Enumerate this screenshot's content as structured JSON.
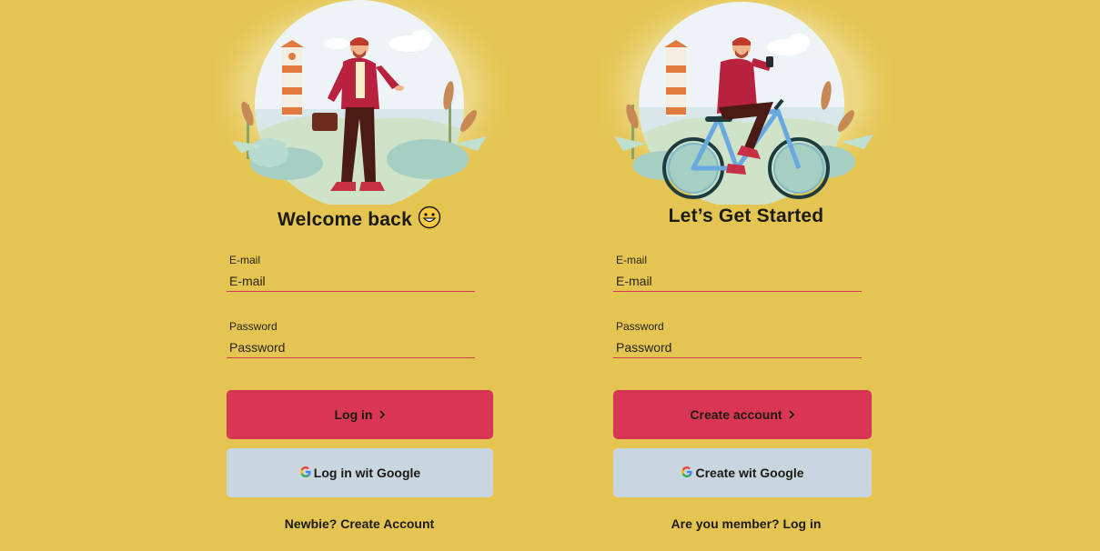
{
  "login": {
    "title": "Welcome back",
    "title_emoji_icon": "grinning-face-icon",
    "email_label": "E-mail",
    "email_placeholder": "E-mail",
    "password_label": "Password",
    "password_placeholder": "Password",
    "submit_label": "Log in",
    "google_label": "Log in wit Google",
    "switch_label": "Newbie? Create Account"
  },
  "signup": {
    "title": "Let’s Get Started",
    "email_label": "E-mail",
    "email_placeholder": "E-mail",
    "password_label": "Password",
    "password_placeholder": "Password",
    "submit_label": "Create account",
    "google_label": "Create wit Google",
    "switch_label": "Are you member? Log in"
  },
  "icons": {
    "submit_chevron": "chevron-right-icon",
    "google": "google-logo-icon"
  },
  "colors": {
    "background": "#e4c552",
    "primary_button": "#d93655",
    "google_button": "#c9d6e0",
    "input_underline": "#d23a55",
    "text": "#1d1a12"
  }
}
